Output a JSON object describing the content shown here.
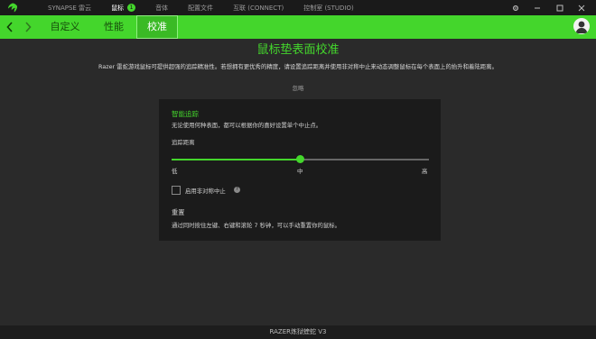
{
  "topnav": {
    "items": [
      {
        "label": "SYNAPSE 雷云",
        "active": false
      },
      {
        "label": "鼠标",
        "active": true,
        "badge": "1"
      },
      {
        "label": "音体",
        "active": false
      },
      {
        "label": "配置文件",
        "active": false
      },
      {
        "label": "互联 (CONNECT)",
        "active": false
      },
      {
        "label": "控制室 (STUDIO)",
        "active": false
      }
    ]
  },
  "tabs": [
    {
      "label": "自定义",
      "active": false
    },
    {
      "label": "性能",
      "active": false
    },
    {
      "label": "校准",
      "active": true
    }
  ],
  "page": {
    "title": "鼠标垫表面校准",
    "description": "Razer 雷蛇游戏鼠标可提供超强的追踪精准性。若想拥有更优秀的精度，请设置追踪距离并使用非对称中止来动态调整鼠标在每个表面上的抬升和着陆距离。",
    "ignore": "忽略"
  },
  "smart_tracking": {
    "title": "智能追踪",
    "description": "无论使用何种表面，都可以根据你的喜好设置单个中止点。",
    "distance_label": "追踪距离",
    "slider": {
      "value_fraction": 0.5,
      "min_label": "低",
      "mid_label": "中",
      "max_label": "高"
    },
    "asymmetric_label": "启用非对称中止",
    "asymmetric_checked": false
  },
  "reset": {
    "title": "重置",
    "description": "通过同时按住左键、右键和滚轮 7 秒钟，可以手动重置你的鼠标。"
  },
  "footer": {
    "device": "RAZER炼狱蝰蛇 V3"
  },
  "colors": {
    "accent": "#44d62c",
    "background": "#2a2a2a",
    "panel": "#1b1b1b",
    "topbar": "#1a1a1a"
  },
  "icons": {
    "logo": "razer-logo-icon",
    "back": "arrow-left-icon",
    "forward": "arrow-right-icon",
    "help": "question-icon"
  }
}
